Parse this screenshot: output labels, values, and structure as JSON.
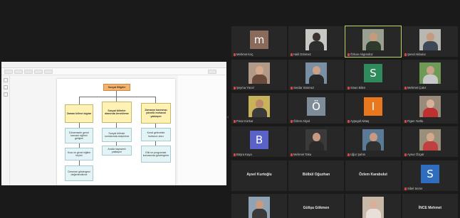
{
  "shared_screen": {
    "menu": [
      "Dosya",
      "Düzen",
      "Görünüm",
      "Ekle",
      "Biçim",
      "Araçlar"
    ],
    "diagram": {
      "top": "Sosyal Bilgiler",
      "mid": [
        "Zaman bilinci algılar",
        "Sosyal bilimler alanında örnekleme",
        "Zamanın kavranışı yönelik mekanın yaklaşım"
      ],
      "leaves_left": [
        "Dönemsele genel kavram eğitimi gelişimi",
        "Kısa ve genel eğitim biçimi",
        "Deneme göstergesi değerlendirme"
      ],
      "leaves_mid": [
        "Sosyal bilimler sonrasında araştırma",
        "Analiz kapsamlı yaklaşım"
      ],
      "leaves_right": [
        "Kural gelecekte kullanıcı arzu",
        "Etki ve programlar konusunda göstergeler"
      ]
    }
  },
  "participants": [
    {
      "name": "Mehmet Koç",
      "type": "initial",
      "initial": "m",
      "color": "#8a6a5a"
    },
    {
      "name": "Halil Dönmez",
      "type": "photo",
      "bg": "#c9c9c4",
      "skin": "#3b3330",
      "shirt": "#2d2d2d"
    },
    {
      "name": "Özkan Akgündüz",
      "type": "photo",
      "bg": "#9aa08f",
      "skin": "#c79a7c",
      "shirt": "#2e3a2a",
      "active": true
    },
    {
      "name": "Şenel Akbulut",
      "type": "photo",
      "bg": "#b8b8b0",
      "skin": "#c49a80",
      "shirt": "#3d4a55"
    },
    {
      "name": "Şeyma Yücel",
      "type": "photo",
      "bg": "#b29a88",
      "skin": "#d4a98c",
      "shirt": "#6a4a3a"
    },
    {
      "name": "Serdar Sönmez",
      "type": "photo",
      "bg": "#7a8fa3",
      "skin": "#c9a088",
      "shirt": "#2a2a2a"
    },
    {
      "name": "Sinan Bilen",
      "type": "initial",
      "initial": "S",
      "color": "#2f8a5c"
    },
    {
      "name": "Mehmet Çakır",
      "type": "photo",
      "bg": "#6e9a55",
      "skin": "#c9a088",
      "shirt": "#c8c8c8"
    },
    {
      "name": "Pınar Korkut",
      "type": "photo",
      "bg": "#c8b25a",
      "skin": "#b98a6a",
      "shirt": "#3a3a3a"
    },
    {
      "name": "Özlem Akyol",
      "type": "initial",
      "initial": "Ö",
      "color": "#7e8c99"
    },
    {
      "name": "Ayşegül Aktaş",
      "type": "initial",
      "initial": "I",
      "color": "#e8771e"
    },
    {
      "name": "Figen Yurtlu",
      "type": "photo",
      "bg": "#9a8a7a",
      "skin": "#d8b09a",
      "shirt": "#bf3030"
    },
    {
      "name": "Büşra Kaya",
      "type": "initial",
      "initial": "B",
      "color": "#5a62c9"
    },
    {
      "name": "Mehmet Toka",
      "type": "photo",
      "bg": "#3a3a3a",
      "skin": "#c99a80",
      "shirt": "#2a2a2a"
    },
    {
      "name": "Uğur Şahin",
      "type": "photo",
      "bg": "#5a7a95",
      "skin": "#c99a80",
      "shirt": "#2f2f2f"
    },
    {
      "name": "Aynur Özgür",
      "type": "photo",
      "bg": "#9a8f7a",
      "skin": "#d3a98c",
      "shirt": "#c04040"
    },
    {
      "name": "Aysel Kurtoğlu",
      "type": "name"
    },
    {
      "name": "Bülbül Oğuzhan",
      "type": "name"
    },
    {
      "name": "Özlem Karabulut",
      "type": "name"
    },
    {
      "name": "Sibel Sezer",
      "type": "initial",
      "initial": "S",
      "color": "#2f6ebf"
    },
    {
      "name": "",
      "type": "photo",
      "bg": "#8fa3b5",
      "skin": "#c99a80",
      "shirt": "#3a3a3a"
    },
    {
      "name": "Gülişa Gökmen",
      "type": "name"
    },
    {
      "name": "",
      "type": "photo",
      "bg": "#c9b8a8",
      "skin": "#d8b09a",
      "shirt": "#e8e0d8"
    },
    {
      "name": "İNCE Mehmet",
      "type": "name"
    }
  ]
}
